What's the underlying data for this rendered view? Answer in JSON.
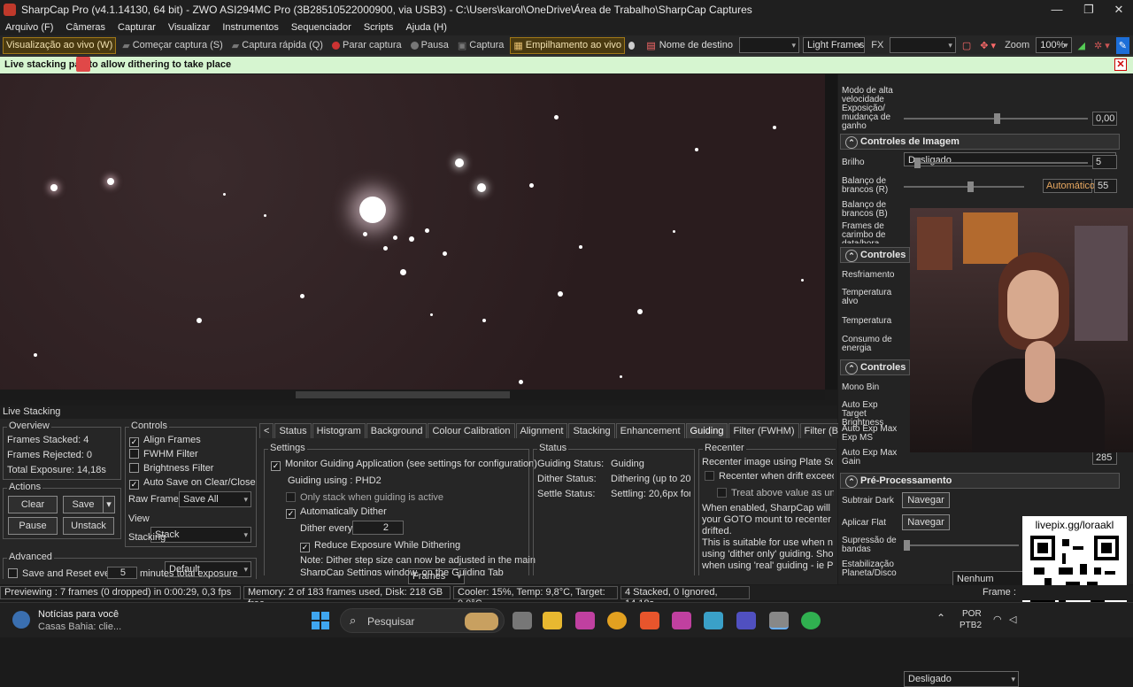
{
  "window": {
    "title": "SharpCap Pro (v4.1.14130, 64 bit) - ZWO ASI294MC Pro (3B28510522000900, via USB3) - C:\\Users\\karol\\OneDrive\\Área de Trabalho\\SharpCap Captures",
    "minimize": "—",
    "maximize": "❐",
    "close": "✕"
  },
  "menu": [
    "Arquivo (F)",
    "Câmeras",
    "Capturar",
    "Visualizar",
    "Instrumentos",
    "Sequenciador",
    "Scripts",
    "Ajuda (H)"
  ],
  "toolbar": {
    "live_view": "Visualização ao vivo (W)",
    "start_capture": "Começar captura (S)",
    "quick_capture": "Captura rápida (Q)",
    "stop_capture": "Parar captura",
    "pause": "Pausa",
    "capture": "Captura",
    "live_stack": "Empilhamento ao vivo",
    "target_name": "Nome de destino",
    "target_value": "",
    "frame_type": "Light Frames",
    "fx_label": "FX",
    "fx_value": "",
    "zoom_label": "Zoom",
    "zoom_value": "100%"
  },
  "notice": {
    "text": "Live stacking pau  to allow dithering to take place"
  },
  "live_stacking": {
    "title": "Live Stacking",
    "overview": {
      "label": "Overview",
      "frames_stacked": "Frames Stacked:  4",
      "frames_rejected": "Frames Rejected:  0",
      "total_exposure": "Total Exposure:    14,18s"
    },
    "actions": {
      "label": "Actions",
      "clear": "Clear",
      "save": "Save",
      "pause": "Pause",
      "unstack": "Unstack"
    },
    "controls": {
      "label": "Controls",
      "align": "Align Frames",
      "fwhm": "FWHM Filter",
      "brightness": "Brightness Filter",
      "autosave": "Auto Save on Clear/Close",
      "raw_frames_label": "Raw Frames",
      "raw_frames": "Save All",
      "view_label": "View",
      "view": "Stack",
      "stacking_label": "Stacking",
      "stacking": "Default"
    },
    "advanced": {
      "label": "Advanced",
      "save_reset": "Save and Reset every",
      "minutes": "5",
      "suffix": "minutes total exposure"
    },
    "tabs": [
      "<",
      "Status",
      "Histogram",
      "Background",
      "Colour Calibration",
      "Alignment",
      "Stacking",
      "Enhancement",
      "Guiding",
      "Filter (FWHM)",
      "Filter (Brightness)",
      "D",
      ">"
    ],
    "settings": {
      "label": "Settings",
      "monitor": "Monitor Guiding Application (see settings for configuration)",
      "guiding_using": "Guiding using :   PHD2",
      "only_stack": "Only stack when guiding is active",
      "auto_dither": "Automatically Dither",
      "dither_every_label": "Dither every:",
      "dither_every": "2",
      "dither_unit": "Frames",
      "reduce_exposure": "Reduce Exposure While Dithering",
      "note": "Note: Dither step size can now be adjusted in the main",
      "note2": "SharpCap Settings window, on the Guiding Tab"
    },
    "status": {
      "label": "Status",
      "guiding_status_label": "Guiding Status:",
      "guiding_status": "Guiding",
      "dither_status_label": "Dither Status:",
      "dither_status": "Dithering (up to 20 |",
      "settle_status_label": "Settle Status:",
      "settle_status": "Settling: 20,6px for ("
    },
    "recenter": {
      "label": "Recenter",
      "line1": "Recenter image using Plate Solvir",
      "chk1": "Recenter when drift exceeds",
      "chk2": "Treat above value as un-b",
      "p1": "When enabled, SharpCap will use",
      "p2": "your GOTO mount to recenter the",
      "p3": "drifted.",
      "p4": "This is suitable for use when not g",
      "p5": "using 'dither only' guiding. Shoul",
      "p6": "when using 'real' guiding - ie PHE"
    }
  },
  "right_panel": {
    "hs_label": "Modo de alta velocidade Exposição/ mudança de ganho",
    "hs_value": "Desligado",
    "hs_num": "0,00",
    "image_controls": "Controles de Imagem",
    "brightness_label": "Brilho",
    "brightness_value": "5",
    "wb_r_label": "Balanço de brancos (R)",
    "wb_auto": "Automático",
    "wb_r_value": "55",
    "wb_b_label": "Balanço de brancos (B)",
    "frames_label": "Frames de carimbo de data/hora",
    "thermal": "Controles téi",
    "cooling_label": "Resfriamento",
    "target_temp_label": "Temperatura alvo",
    "temp_label": "Temperatura",
    "power_label": "Consumo de energia",
    "misc": "Controles div",
    "mono_bin_label": "Mono Bin",
    "ae_target_label": "Auto Exp Target Brightness",
    "ae_max_label": "Auto Exp Max Exp MS",
    "ae_gain_label": "Auto Exp Max Gain",
    "ae_gain_value": "285",
    "preproc": "Pré-Processamento",
    "dark_label": "Subtrair Dark",
    "browse": "Navegar",
    "none": "Nenhum",
    "flat_label": "Aplicar Flat",
    "banding_label": "Supressão de bandas",
    "stab_label": "Estabilização Planeta/Disco",
    "stab_value": "Desligado"
  },
  "overlay": {
    "qr_caption": "livepix.gg/loraakl"
  },
  "statusbar": {
    "preview": "Previewing : 7 frames (0 dropped) in 0:00:29, 0,3 fps",
    "memory": "Memory: 2 of 183 frames used, Disk: 218 GB free",
    "cooler": "Cooler: 15%, Temp: 9,8°C, Target: 0,0°C",
    "stacked": "4 Stacked, 0 Ignored, 14,18s",
    "frame": "Frame :"
  },
  "taskbar": {
    "news_title": "Notícias para você",
    "news_sub": "Casas Bahia: clie...",
    "search": "Pesquisar",
    "lang1": "POR",
    "lang2": "PTB2"
  }
}
